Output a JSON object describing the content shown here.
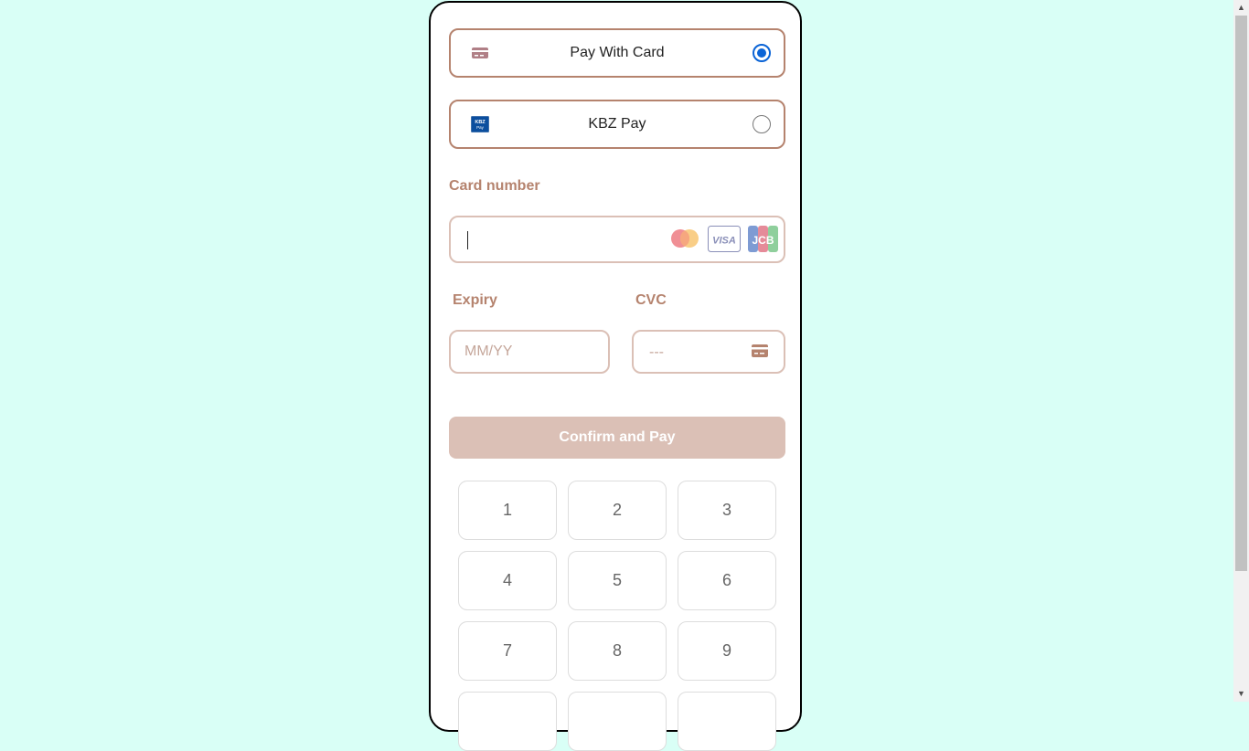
{
  "payment_methods": [
    {
      "label": "Pay With Card",
      "icon": "credit-card-icon",
      "selected": true
    },
    {
      "label": "KBZ Pay",
      "icon": "kbz-pay-logo",
      "selected": false
    }
  ],
  "kbz_logo_text": "KBZ Pay",
  "card_number": {
    "label": "Card number",
    "value": "",
    "brands": [
      "Mastercard",
      "Visa",
      "JCB"
    ]
  },
  "visa_text": "VISA",
  "jcb_text": "JCB",
  "expiry": {
    "label": "Expiry",
    "placeholder": "MM/YY"
  },
  "cvc": {
    "label": "CVC",
    "placeholder": "---"
  },
  "confirm_label": "Confirm and Pay",
  "keypad": [
    "1",
    "2",
    "3",
    "4",
    "5",
    "6",
    "7",
    "8",
    "9"
  ],
  "colors": {
    "page_bg": "#d9fff6",
    "accent": "#b5836e",
    "input_border": "#dbc0b6",
    "button_bg": "#dbc0b6",
    "radio_selected": "#0b64d6"
  }
}
